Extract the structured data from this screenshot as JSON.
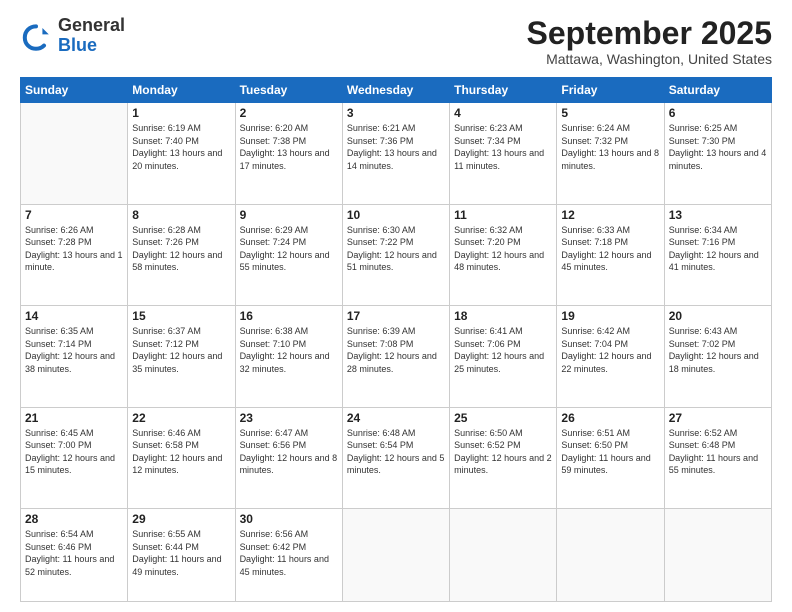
{
  "header": {
    "logo_general": "General",
    "logo_blue": "Blue",
    "month_title": "September 2025",
    "location": "Mattawa, Washington, United States"
  },
  "weekdays": [
    "Sunday",
    "Monday",
    "Tuesday",
    "Wednesday",
    "Thursday",
    "Friday",
    "Saturday"
  ],
  "weeks": [
    [
      {
        "day": "",
        "sunrise": "",
        "sunset": "",
        "daylight": ""
      },
      {
        "day": "1",
        "sunrise": "Sunrise: 6:19 AM",
        "sunset": "Sunset: 7:40 PM",
        "daylight": "Daylight: 13 hours and 20 minutes."
      },
      {
        "day": "2",
        "sunrise": "Sunrise: 6:20 AM",
        "sunset": "Sunset: 7:38 PM",
        "daylight": "Daylight: 13 hours and 17 minutes."
      },
      {
        "day": "3",
        "sunrise": "Sunrise: 6:21 AM",
        "sunset": "Sunset: 7:36 PM",
        "daylight": "Daylight: 13 hours and 14 minutes."
      },
      {
        "day": "4",
        "sunrise": "Sunrise: 6:23 AM",
        "sunset": "Sunset: 7:34 PM",
        "daylight": "Daylight: 13 hours and 11 minutes."
      },
      {
        "day": "5",
        "sunrise": "Sunrise: 6:24 AM",
        "sunset": "Sunset: 7:32 PM",
        "daylight": "Daylight: 13 hours and 8 minutes."
      },
      {
        "day": "6",
        "sunrise": "Sunrise: 6:25 AM",
        "sunset": "Sunset: 7:30 PM",
        "daylight": "Daylight: 13 hours and 4 minutes."
      }
    ],
    [
      {
        "day": "7",
        "sunrise": "Sunrise: 6:26 AM",
        "sunset": "Sunset: 7:28 PM",
        "daylight": "Daylight: 13 hours and 1 minute."
      },
      {
        "day": "8",
        "sunrise": "Sunrise: 6:28 AM",
        "sunset": "Sunset: 7:26 PM",
        "daylight": "Daylight: 12 hours and 58 minutes."
      },
      {
        "day": "9",
        "sunrise": "Sunrise: 6:29 AM",
        "sunset": "Sunset: 7:24 PM",
        "daylight": "Daylight: 12 hours and 55 minutes."
      },
      {
        "day": "10",
        "sunrise": "Sunrise: 6:30 AM",
        "sunset": "Sunset: 7:22 PM",
        "daylight": "Daylight: 12 hours and 51 minutes."
      },
      {
        "day": "11",
        "sunrise": "Sunrise: 6:32 AM",
        "sunset": "Sunset: 7:20 PM",
        "daylight": "Daylight: 12 hours and 48 minutes."
      },
      {
        "day": "12",
        "sunrise": "Sunrise: 6:33 AM",
        "sunset": "Sunset: 7:18 PM",
        "daylight": "Daylight: 12 hours and 45 minutes."
      },
      {
        "day": "13",
        "sunrise": "Sunrise: 6:34 AM",
        "sunset": "Sunset: 7:16 PM",
        "daylight": "Daylight: 12 hours and 41 minutes."
      }
    ],
    [
      {
        "day": "14",
        "sunrise": "Sunrise: 6:35 AM",
        "sunset": "Sunset: 7:14 PM",
        "daylight": "Daylight: 12 hours and 38 minutes."
      },
      {
        "day": "15",
        "sunrise": "Sunrise: 6:37 AM",
        "sunset": "Sunset: 7:12 PM",
        "daylight": "Daylight: 12 hours and 35 minutes."
      },
      {
        "day": "16",
        "sunrise": "Sunrise: 6:38 AM",
        "sunset": "Sunset: 7:10 PM",
        "daylight": "Daylight: 12 hours and 32 minutes."
      },
      {
        "day": "17",
        "sunrise": "Sunrise: 6:39 AM",
        "sunset": "Sunset: 7:08 PM",
        "daylight": "Daylight: 12 hours and 28 minutes."
      },
      {
        "day": "18",
        "sunrise": "Sunrise: 6:41 AM",
        "sunset": "Sunset: 7:06 PM",
        "daylight": "Daylight: 12 hours and 25 minutes."
      },
      {
        "day": "19",
        "sunrise": "Sunrise: 6:42 AM",
        "sunset": "Sunset: 7:04 PM",
        "daylight": "Daylight: 12 hours and 22 minutes."
      },
      {
        "day": "20",
        "sunrise": "Sunrise: 6:43 AM",
        "sunset": "Sunset: 7:02 PM",
        "daylight": "Daylight: 12 hours and 18 minutes."
      }
    ],
    [
      {
        "day": "21",
        "sunrise": "Sunrise: 6:45 AM",
        "sunset": "Sunset: 7:00 PM",
        "daylight": "Daylight: 12 hours and 15 minutes."
      },
      {
        "day": "22",
        "sunrise": "Sunrise: 6:46 AM",
        "sunset": "Sunset: 6:58 PM",
        "daylight": "Daylight: 12 hours and 12 minutes."
      },
      {
        "day": "23",
        "sunrise": "Sunrise: 6:47 AM",
        "sunset": "Sunset: 6:56 PM",
        "daylight": "Daylight: 12 hours and 8 minutes."
      },
      {
        "day": "24",
        "sunrise": "Sunrise: 6:48 AM",
        "sunset": "Sunset: 6:54 PM",
        "daylight": "Daylight: 12 hours and 5 minutes."
      },
      {
        "day": "25",
        "sunrise": "Sunrise: 6:50 AM",
        "sunset": "Sunset: 6:52 PM",
        "daylight": "Daylight: 12 hours and 2 minutes."
      },
      {
        "day": "26",
        "sunrise": "Sunrise: 6:51 AM",
        "sunset": "Sunset: 6:50 PM",
        "daylight": "Daylight: 11 hours and 59 minutes."
      },
      {
        "day": "27",
        "sunrise": "Sunrise: 6:52 AM",
        "sunset": "Sunset: 6:48 PM",
        "daylight": "Daylight: 11 hours and 55 minutes."
      }
    ],
    [
      {
        "day": "28",
        "sunrise": "Sunrise: 6:54 AM",
        "sunset": "Sunset: 6:46 PM",
        "daylight": "Daylight: 11 hours and 52 minutes."
      },
      {
        "day": "29",
        "sunrise": "Sunrise: 6:55 AM",
        "sunset": "Sunset: 6:44 PM",
        "daylight": "Daylight: 11 hours and 49 minutes."
      },
      {
        "day": "30",
        "sunrise": "Sunrise: 6:56 AM",
        "sunset": "Sunset: 6:42 PM",
        "daylight": "Daylight: 11 hours and 45 minutes."
      },
      {
        "day": "",
        "sunrise": "",
        "sunset": "",
        "daylight": ""
      },
      {
        "day": "",
        "sunrise": "",
        "sunset": "",
        "daylight": ""
      },
      {
        "day": "",
        "sunrise": "",
        "sunset": "",
        "daylight": ""
      },
      {
        "day": "",
        "sunrise": "",
        "sunset": "",
        "daylight": ""
      }
    ]
  ]
}
